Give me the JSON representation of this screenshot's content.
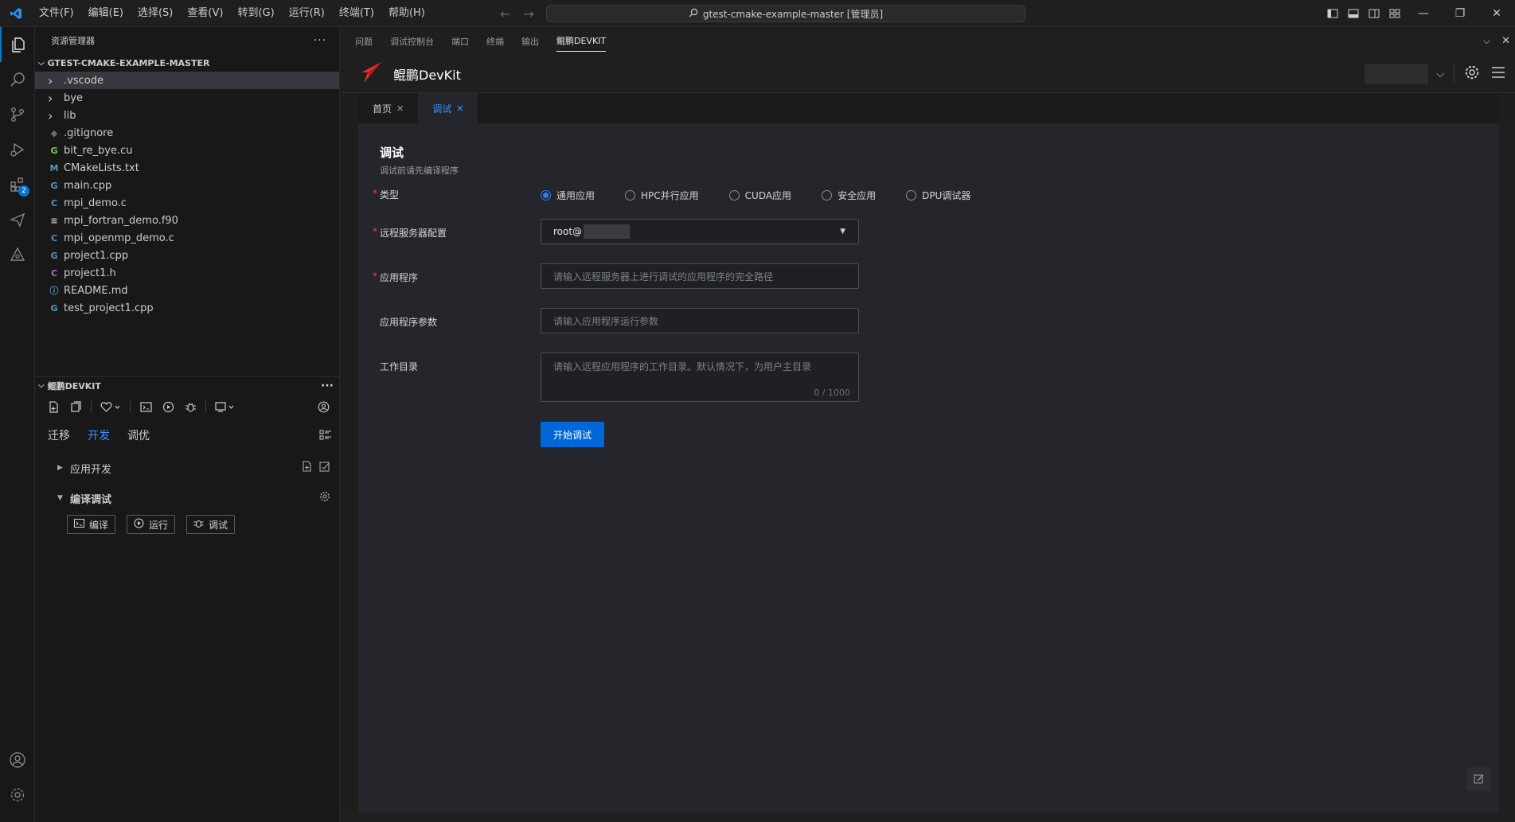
{
  "titlebar": {
    "menus": [
      "文件(F)",
      "编辑(E)",
      "选择(S)",
      "查看(V)",
      "转到(G)",
      "运行(R)",
      "终端(T)",
      "帮助(H)"
    ],
    "search_text": "gtest-cmake-example-master [管理员]"
  },
  "explorer": {
    "title": "资源管理器",
    "root": "GTEST-CMAKE-EXAMPLE-MASTER",
    "files": [
      {
        "name": ".vscode",
        "kind": "folder",
        "icon": "chevron-right-icon"
      },
      {
        "name": "bye",
        "kind": "folder",
        "icon": "chevron-right-icon"
      },
      {
        "name": "lib",
        "kind": "folder",
        "icon": "chevron-right-icon"
      },
      {
        "name": ".gitignore",
        "kind": "file",
        "icon": "git-icon",
        "glyph": "◆",
        "color": "#6b6b6b"
      },
      {
        "name": "bit_re_bye.cu",
        "kind": "file",
        "icon": "cuda-file-icon",
        "glyph": "G",
        "color": "#8dc149"
      },
      {
        "name": "CMakeLists.txt",
        "kind": "file",
        "icon": "markdown-m-icon",
        "glyph": "M",
        "color": "#519aba"
      },
      {
        "name": "main.cpp",
        "kind": "file",
        "icon": "cpp-file-icon",
        "glyph": "G",
        "color": "#519aba"
      },
      {
        "name": "mpi_demo.c",
        "kind": "file",
        "icon": "c-file-icon",
        "glyph": "C",
        "color": "#519aba"
      },
      {
        "name": "mpi_fortran_demo.f90",
        "kind": "file",
        "icon": "text-file-icon",
        "glyph": "≡",
        "color": "#cccccc"
      },
      {
        "name": "mpi_openmp_demo.c",
        "kind": "file",
        "icon": "c-file-icon",
        "glyph": "C",
        "color": "#519aba"
      },
      {
        "name": "project1.cpp",
        "kind": "file",
        "icon": "cpp-file-icon",
        "glyph": "G",
        "color": "#519aba"
      },
      {
        "name": "project1.h",
        "kind": "file",
        "icon": "header-file-icon",
        "glyph": "C",
        "color": "#a074c4"
      },
      {
        "name": "README.md",
        "kind": "file",
        "icon": "info-icon",
        "glyph": "ⓘ",
        "color": "#519aba"
      },
      {
        "name": "test_project1.cpp",
        "kind": "file",
        "icon": "cpp-file-icon",
        "glyph": "G",
        "color": "#519aba"
      }
    ]
  },
  "devkit_panel": {
    "title": "鲲鹏DEVKIT",
    "tabs": [
      "迁移",
      "开发",
      "调优"
    ],
    "active_tab": "开发",
    "groups": {
      "app_dev": "应用开发",
      "compile_debug": "编译调试"
    },
    "buttons": {
      "compile": "编译",
      "run": "运行",
      "debug": "调试"
    }
  },
  "panel_tabs": [
    "问题",
    "调试控制台",
    "端口",
    "终端",
    "输出",
    "鲲鹏DEVKIT"
  ],
  "active_panel_tab": "鲲鹏DEVKIT",
  "devkit_header": {
    "brand": "鲲鹏DevKit"
  },
  "editor_tabs": [
    {
      "label": "首页",
      "active": false
    },
    {
      "label": "调试",
      "active": true
    }
  ],
  "form": {
    "title": "调试",
    "subtitle": "调试前请先编译程序",
    "type_label": "类型",
    "type_options": [
      "通用应用",
      "HPC并行应用",
      "CUDA应用",
      "安全应用",
      "DPU调试器"
    ],
    "type_selected": "通用应用",
    "server_label": "远程服务器配置",
    "server_value": "root@",
    "app_label": "应用程序",
    "app_placeholder": "请输入远程服务器上进行调试的应用程序的完全路径",
    "args_label": "应用程序参数",
    "args_placeholder": "请输入应用程序运行参数",
    "workdir_label": "工作目录",
    "workdir_placeholder": "请输入远程应用程序的工作目录。默认情况下，为用户主目录",
    "workdir_counter": "0 / 1000",
    "submit": "开始调试"
  },
  "colors": {
    "accent": "#0067d8",
    "link_blue": "#3794ff",
    "required": "#e8453c",
    "brand_red": "#e8312a"
  }
}
